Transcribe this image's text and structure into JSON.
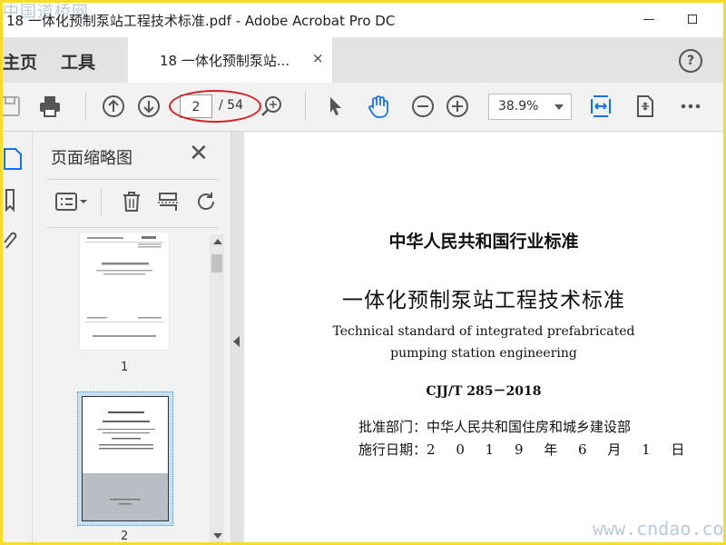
{
  "window": {
    "title": "18 一体化预制泵站工程技术标准.pdf - Adobe Acrobat Pro DC",
    "watermark": "中国道桥网"
  },
  "tabs": {
    "home": "主页",
    "tools": "工具",
    "document": "18 一体化预制泵站...",
    "close_glyph": "×",
    "help_glyph": "?"
  },
  "toolbar": {
    "current_page": "2",
    "total_pages": "/ 54",
    "zoom": "38.9%",
    "icons": [
      "save-icon",
      "print-icon",
      "prev-page-icon",
      "next-page-icon",
      "zoom-search-icon",
      "select-arrow-icon",
      "hand-icon",
      "zoom-out-icon",
      "zoom-in-icon",
      "fit-width-icon",
      "rotate-page-icon",
      "more-icon"
    ],
    "accent_color": "#1473e6",
    "highlight_color": "#d62020"
  },
  "panel": {
    "title": "页面缩略图",
    "close_glyph": "✕",
    "thumbnails": [
      {
        "page_label": "1",
        "selected": false
      },
      {
        "page_label": "2",
        "selected": true
      }
    ]
  },
  "document": {
    "standard_type": "中华人民共和国行业标准",
    "title_cn": "一体化预制泵站工程技术标准",
    "title_en_1": "Technical standard of integrated prefabricated",
    "title_en_2": "pumping station engineering",
    "code": "CJJ/T 285－2018",
    "approval_label": "批准部门：",
    "approval_value": "中华人民共和国住房和城乡建设部",
    "date_label": "施行日期：",
    "date_value": "2 0 1 9 年 6 月 1 日"
  },
  "watermark_bottom": "www.cndao.com"
}
